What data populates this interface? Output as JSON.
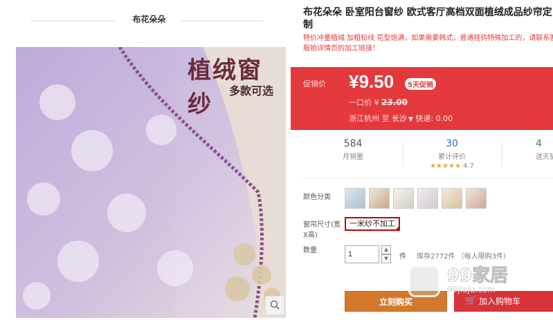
{
  "store": {
    "name": "布花朵朵"
  },
  "image": {
    "title": "植绒窗纱",
    "subtitle": "多款可选"
  },
  "product": {
    "title": "布花朵朵 卧室阳台窗纱 欧式客厅高档双面植绒成品纱帘定制",
    "subtitle": "特价冲量植绒 加粗铅线 花型饱满，如果需要韩式，普通挂钩特殊加工的，请联系客服拍详情页的加工链接！"
  },
  "price": {
    "label": "促销价",
    "value": "¥9.50",
    "badge": "5天促销",
    "original_label": "一口价 ¥",
    "original_value": "23.00",
    "shipping_from": "浙江杭州",
    "shipping_to_word": "至",
    "shipping_city": "长沙",
    "shipping_fee": "快递: 0.00"
  },
  "stats": {
    "monthly_sales": {
      "value": "584",
      "label": "月销量"
    },
    "reviews": {
      "value": "30",
      "label": "累计评价",
      "stars": "★★★★★",
      "score": "4.7"
    },
    "third": {
      "value": "4",
      "label": "送天猫"
    }
  },
  "options": {
    "color_label": "颜色分类",
    "size_label_1": "窗帘尺寸(宽",
    "size_label_2": "X高)",
    "size_value": "一米纱不加工",
    "qty_label": "数量",
    "qty_value": "1",
    "unit": "件",
    "stock": "库存2772件  （每人限购3件）"
  },
  "buttons": {
    "buy": "立刻购买",
    "cart": "加入购物车"
  },
  "watermark": {
    "text": "99家居",
    "url": "99jiaju.com"
  },
  "colors": {
    "accent": "#e4393c",
    "buy": "#d4792c",
    "cart": "#d8333a"
  },
  "icons": {
    "zoom": "search-icon",
    "cart": "cart-icon",
    "chevron": "chevron-down-icon"
  }
}
